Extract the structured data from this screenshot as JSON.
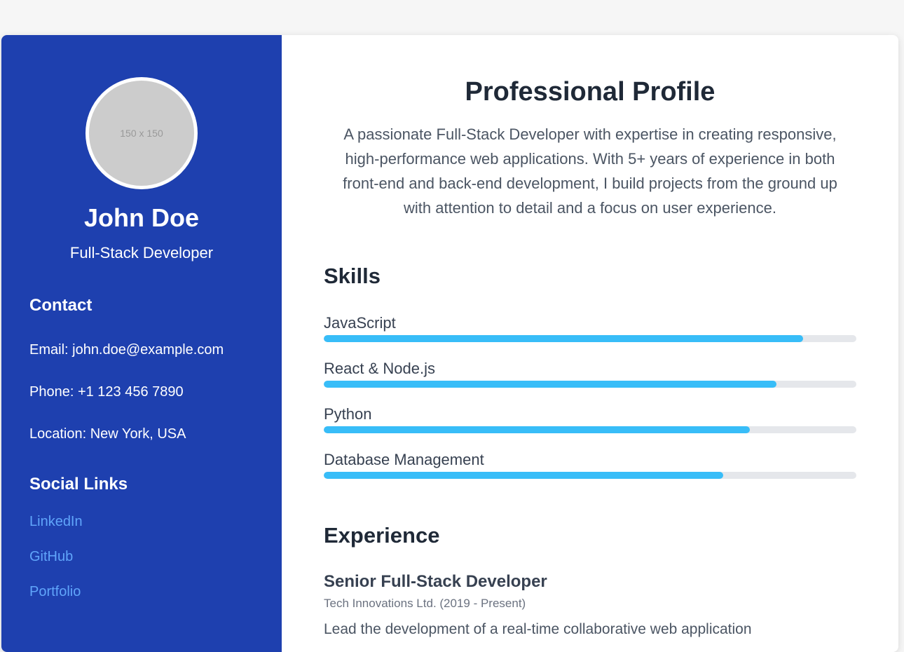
{
  "sidebar": {
    "avatar_text": "150 x 150",
    "name": "John Doe",
    "role": "Full-Stack Developer",
    "contact_heading": "Contact",
    "email": "Email: john.doe@example.com",
    "phone": "Phone: +1 123 456 7890",
    "location": "Location: New York, USA",
    "social_heading": "Social Links",
    "links": [
      {
        "label": "LinkedIn"
      },
      {
        "label": "GitHub"
      },
      {
        "label": "Portfolio"
      }
    ]
  },
  "main": {
    "profile_title": "Professional Profile",
    "profile_text": "A passionate Full-Stack Developer with expertise in creating responsive, high-performance web applications. With 5+ years of experience in both front-end and back-end development, I build projects from the ground up with attention to detail and a focus on user experience.",
    "skills_heading": "Skills",
    "skills": [
      {
        "name": "JavaScript",
        "level": 90
      },
      {
        "name": "React & Node.js",
        "level": 85
      },
      {
        "name": "Python",
        "level": 80
      },
      {
        "name": "Database Management",
        "level": 75
      }
    ],
    "experience_heading": "Experience",
    "job": {
      "title": "Senior Full-Stack Developer",
      "meta": "Tech Innovations Ltd. (2019 - Present)",
      "description": "Lead the development of a real-time collaborative web application"
    }
  },
  "colors": {
    "sidebar_bg": "#1e40af",
    "accent": "#38bdf8",
    "link": "#60a5fa"
  }
}
